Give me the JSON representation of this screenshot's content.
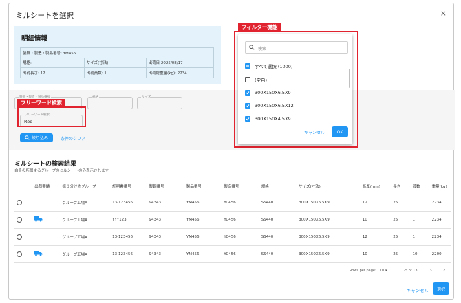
{
  "dialog": {
    "title": "ミルシートを選択",
    "close_glyph": "×"
  },
  "detail": {
    "title": "明細情報",
    "product_info": "製鋼・製造・製品番号: YM456",
    "spec": "規格:",
    "size": "サイズ(寸法):",
    "ship_date": "出荷日  2025/08/17",
    "ship_length": "出荷長さ: 12",
    "ship_count": "出荷員数: 1",
    "ship_weight": "出荷総重量(kg): 2234"
  },
  "filters": {
    "product_no_label": "製鋼・製造・製品番号",
    "spec_label": "規格",
    "size_label": "サイズ",
    "freeword_label": "フリーワード検索",
    "freeword_value": "Red",
    "apply_label": "絞り込み",
    "clear_label": "条件のクリア"
  },
  "callouts": {
    "freeword": "フリーワード検索",
    "filter_feature": "フィルター機能"
  },
  "popup": {
    "search_placeholder": "検索",
    "items": [
      {
        "label": "すべて選択 (1000)",
        "state": "indeterminate"
      },
      {
        "label": "(空白)",
        "state": "unchecked"
      },
      {
        "label": "300X150X6.5X9",
        "state": "checked"
      },
      {
        "label": "300X150X6.5X12",
        "state": "checked"
      },
      {
        "label": "300X150X4.5X9",
        "state": "checked"
      }
    ],
    "cancel_label": "キャンセル",
    "ok_label": "OK"
  },
  "results": {
    "title": "ミルシートの検索結果",
    "subtitle": "自身の所属するグループのミルシートのみ表示されます",
    "columns": [
      "",
      "出荷実績",
      "振り分け先グループ",
      "証明書番号",
      "製鋼番号",
      "製品番号",
      "製造番号",
      "規格",
      "サイズ(寸法)",
      "板厚(mm)",
      "長さ",
      "員数",
      "重量(kg)"
    ],
    "rows": [
      {
        "shipped": false,
        "group": "グループ工場A",
        "cert": "13-123456",
        "steel": "94343",
        "product": "YM456",
        "mfg": "YC456",
        "spec": "SS440",
        "size": "300X150X6.5X9",
        "thickness": "12",
        "length": "25",
        "count": "1",
        "weight": "2234"
      },
      {
        "shipped": true,
        "group": "グループ工場A",
        "cert": "YYY123",
        "steel": "94343",
        "product": "YM456",
        "mfg": "YC456",
        "spec": "SS440",
        "size": "300X150X6.5X9",
        "thickness": "10",
        "length": "25",
        "count": "1",
        "weight": "2234"
      },
      {
        "shipped": false,
        "group": "グループ工場A",
        "cert": "13-123456",
        "steel": "94343",
        "product": "YM456",
        "mfg": "YC456",
        "spec": "SS440",
        "size": "300X150X6.5X9",
        "thickness": "12",
        "length": "25",
        "count": "1",
        "weight": "2234"
      },
      {
        "shipped": true,
        "group": "グループ工場A",
        "cert": "13-123456",
        "steel": "94343",
        "product": "YM456",
        "mfg": "YC456",
        "spec": "SS440",
        "size": "300X150X6.5X9",
        "thickness": "10",
        "length": "25",
        "count": "10",
        "weight": "2200"
      }
    ]
  },
  "pagination": {
    "rows_per_page_label": "Rows per page:",
    "rows_per_page_value": "10",
    "range": "1-5 of 13"
  },
  "actions": {
    "cancel_label": "キャンセル",
    "select_label": "選択"
  },
  "colors": {
    "accent": "#2196f3",
    "highlight": "#e0232f",
    "detail_bg": "#e3f2fb"
  }
}
